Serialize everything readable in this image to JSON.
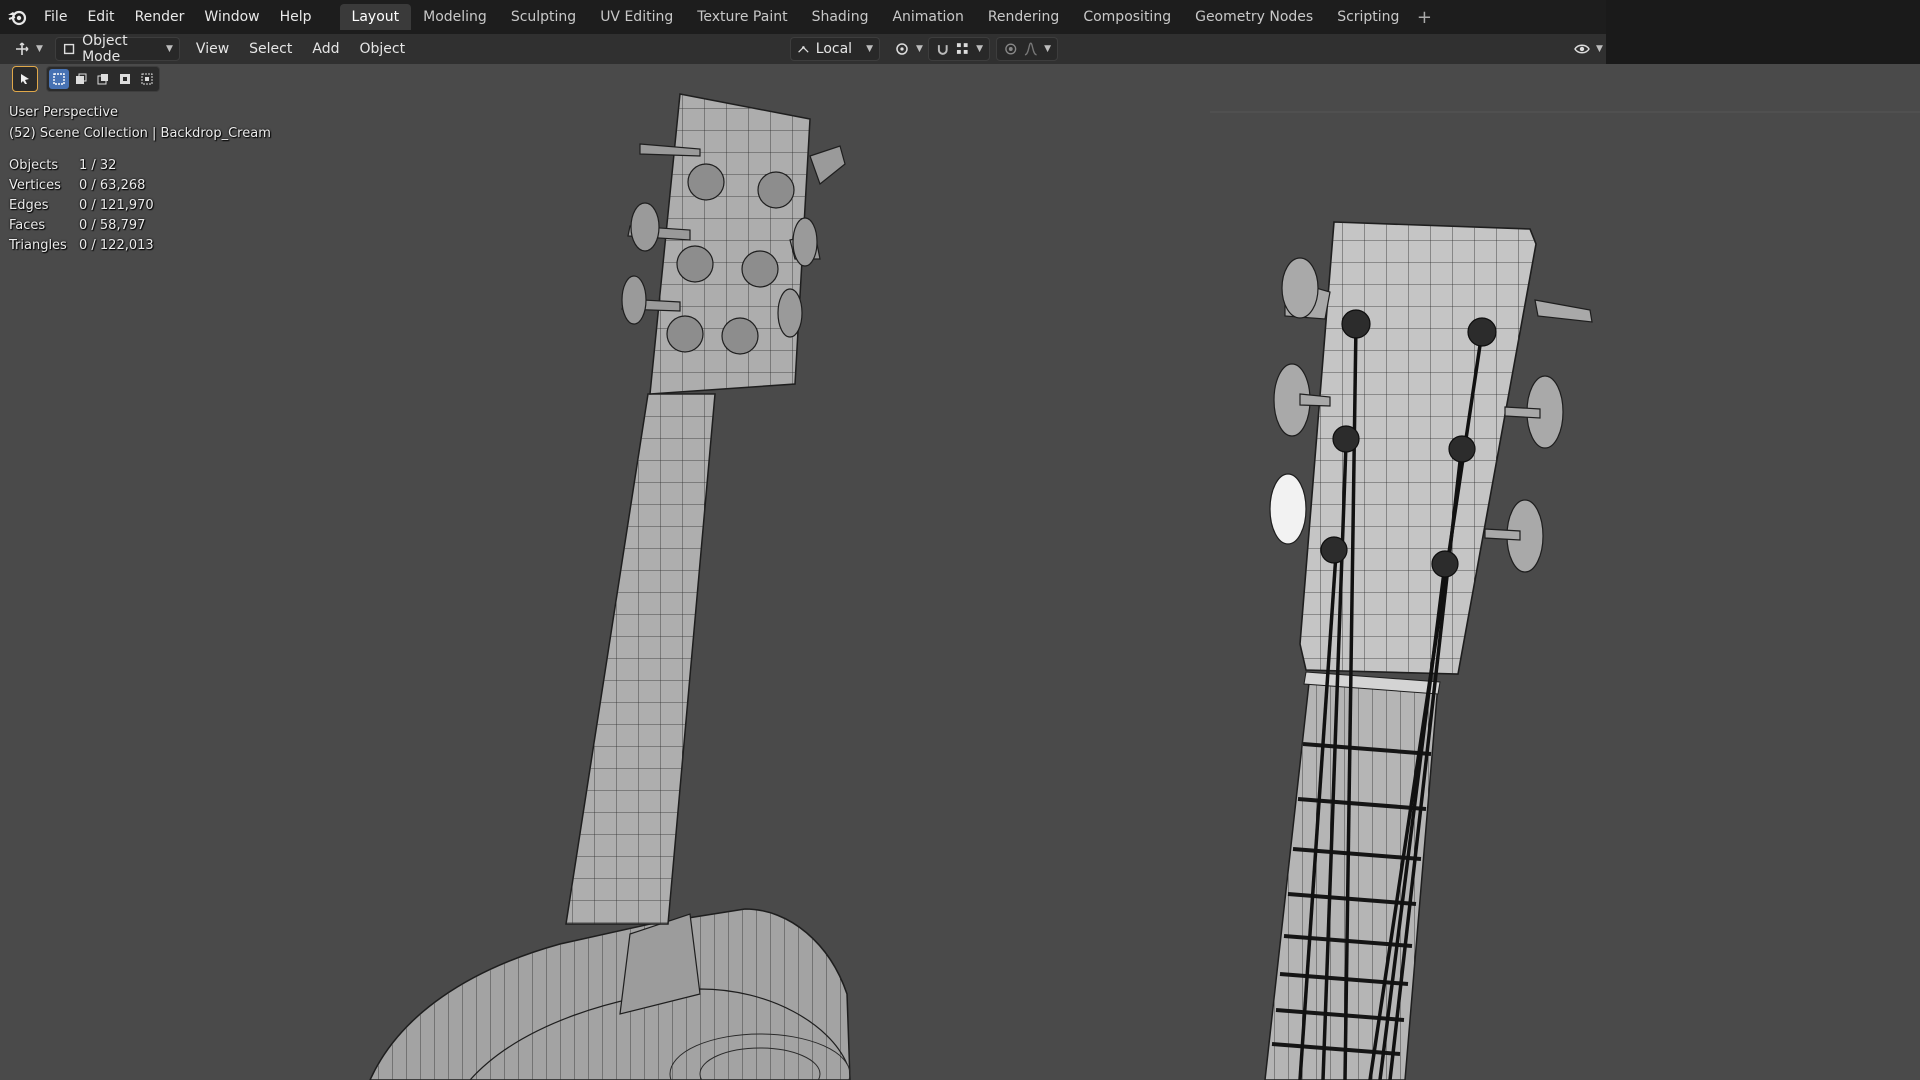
{
  "menu": {
    "items": [
      "File",
      "Edit",
      "Render",
      "Window",
      "Help"
    ]
  },
  "workspaces": {
    "tabs": [
      "Layout",
      "Modeling",
      "Sculpting",
      "UV Editing",
      "Texture Paint",
      "Shading",
      "Animation",
      "Rendering",
      "Compositing",
      "Geometry Nodes",
      "Scripting"
    ],
    "active": "Layout",
    "add_symbol": "+"
  },
  "header": {
    "mode": "Object Mode",
    "menus": [
      "View",
      "Select",
      "Add",
      "Object"
    ],
    "transform_orientation": "Local"
  },
  "viewport": {
    "view_name": "User Perspective",
    "collection": "(52) Scene Collection | Backdrop_Cream",
    "stats": [
      {
        "label": "Objects",
        "value": "1 / 32"
      },
      {
        "label": "Vertices",
        "value": "0 / 63,268"
      },
      {
        "label": "Edges",
        "value": "0 / 121,970"
      },
      {
        "label": "Faces",
        "value": "0 / 58,797"
      },
      {
        "label": "Triangles",
        "value": "0 / 122,013"
      }
    ]
  },
  "colors": {
    "viewport_bg": "#4a4a4a",
    "topbar_bg": "#1d1d1d",
    "header_bg": "#303030",
    "accent_blue": "#4772b3",
    "wire": "#1e1e1e",
    "mesh": "#a8a8a8"
  }
}
